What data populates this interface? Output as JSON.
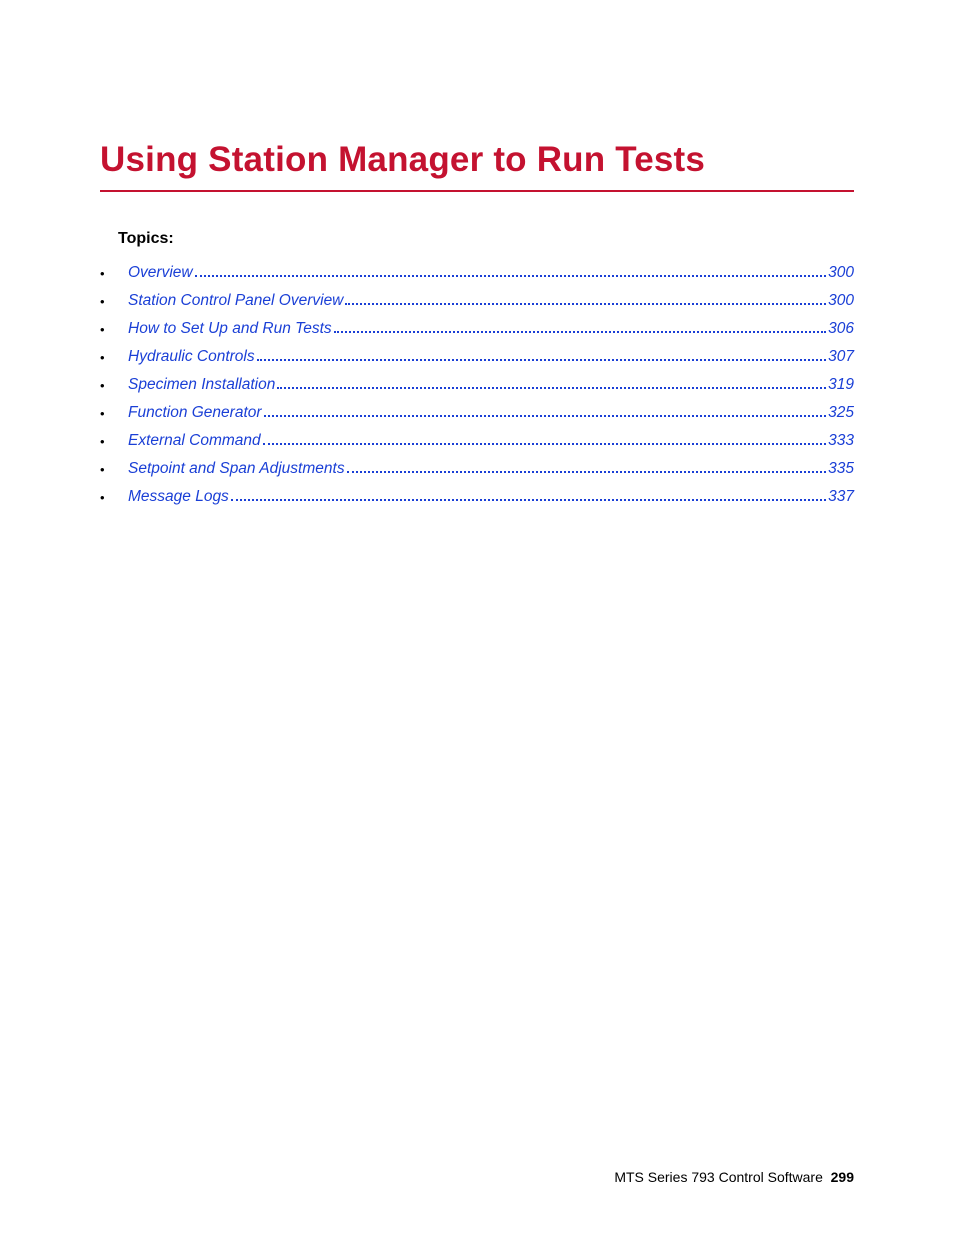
{
  "chapter": {
    "title": "Using Station Manager to Run Tests"
  },
  "topics": {
    "heading": "Topics:",
    "items": [
      {
        "label": "Overview",
        "page": "300"
      },
      {
        "label": "Station Control Panel Overview",
        "page": "300"
      },
      {
        "label": "How to Set Up and Run Tests",
        "page": "306"
      },
      {
        "label": "Hydraulic Controls",
        "page": "307"
      },
      {
        "label": "Specimen Installation",
        "page": "319"
      },
      {
        "label": "Function Generator",
        "page": "325"
      },
      {
        "label": "External Command",
        "page": "333"
      },
      {
        "label": "Setpoint and Span Adjustments",
        "page": "335"
      },
      {
        "label": "Message Logs",
        "page": "337"
      }
    ]
  },
  "footer": {
    "doc_title": "MTS Series 793 Control Software",
    "page_number": "299"
  }
}
